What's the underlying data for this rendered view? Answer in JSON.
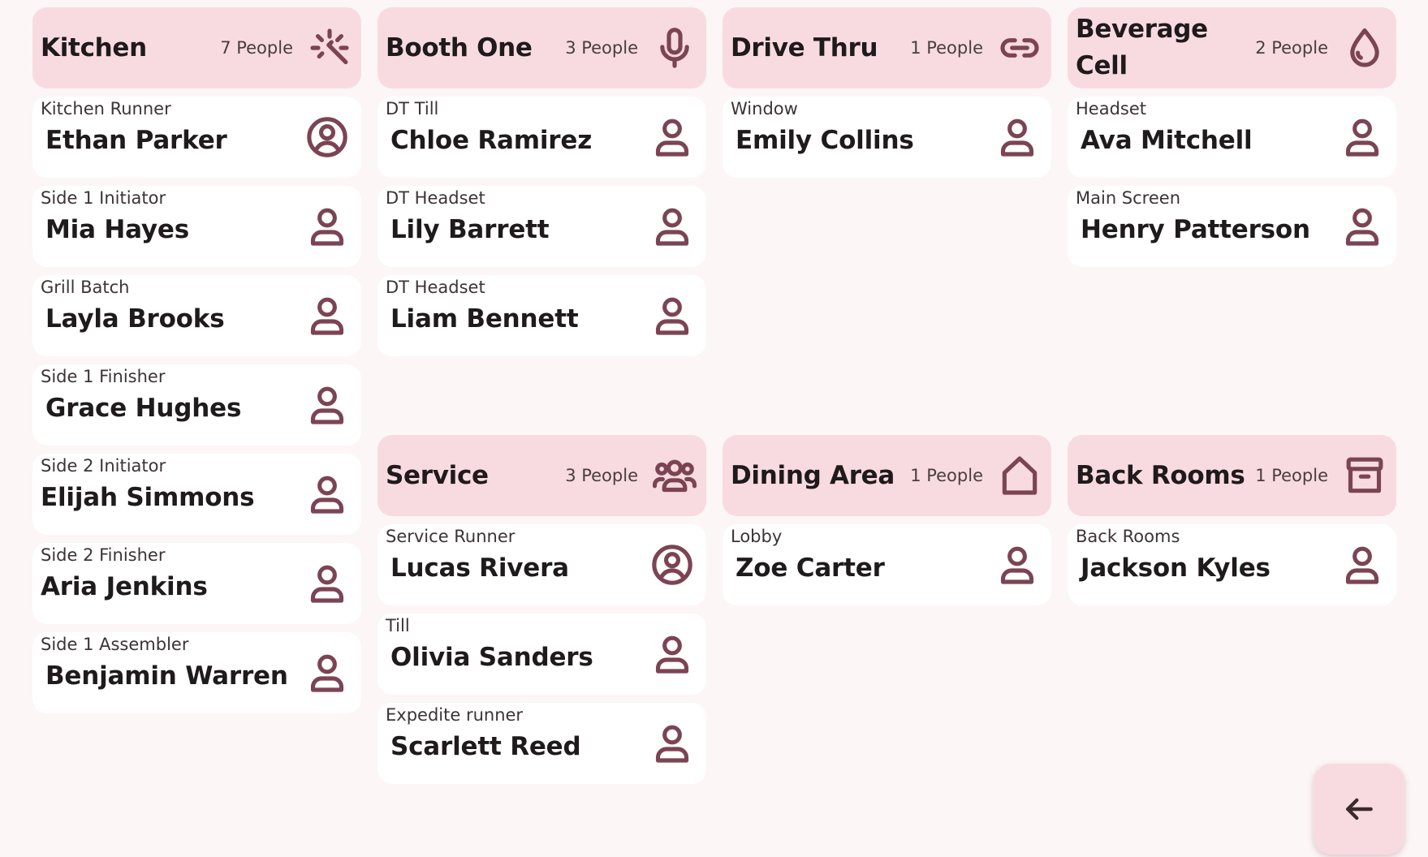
{
  "colors": {
    "background": "#fdf6f6",
    "header": "#f8dbe0",
    "card": "#ffffff",
    "accent": "#7b4454"
  },
  "sections": {
    "kitchen": {
      "title": "Kitchen",
      "count": "7 People",
      "icon": "magic-wand-icon",
      "people": [
        {
          "role": "Kitchen Runner",
          "name": "Ethan Parker",
          "icon": "user-circle-icon"
        },
        {
          "role": "Side 1 Initiator",
          "name": "Mia Hayes",
          "icon": "user-icon"
        },
        {
          "role": "Grill Batch",
          "name": "Layla Brooks",
          "icon": "user-icon"
        },
        {
          "role": "Side 1 Finisher",
          "name": "Grace Hughes",
          "icon": "user-icon"
        },
        {
          "role": "Side 2 Initiator",
          "name": "Elijah Simmons",
          "icon": "user-icon"
        },
        {
          "role": "Side 2 Finisher",
          "name": "Aria Jenkins",
          "icon": "user-icon"
        },
        {
          "role": "Side 1 Assembler",
          "name": "Benjamin Warren",
          "icon": "user-icon"
        }
      ]
    },
    "booth_one": {
      "title": "Booth One",
      "count": "3 People",
      "icon": "microphone-icon",
      "people": [
        {
          "role": "DT Till",
          "name": "Chloe Ramirez",
          "icon": "user-icon"
        },
        {
          "role": "DT Headset",
          "name": "Lily Barrett",
          "icon": "user-icon"
        },
        {
          "role": "DT Headset",
          "name": "Liam Bennett",
          "icon": "user-icon"
        }
      ]
    },
    "drive_thru": {
      "title": "Drive Thru",
      "count": "1 People",
      "icon": "link-icon",
      "people": [
        {
          "role": "Window",
          "name": "Emily Collins",
          "icon": "user-icon"
        }
      ]
    },
    "beverage_cell": {
      "title": "Beverage Cell",
      "count": "2 People",
      "icon": "droplet-icon",
      "people": [
        {
          "role": "Headset",
          "name": "Ava Mitchell",
          "icon": "user-icon"
        },
        {
          "role": "Main Screen",
          "name": "Henry Patterson",
          "icon": "user-icon"
        }
      ]
    },
    "service": {
      "title": "Service",
      "count": "3 People",
      "icon": "users-group-icon",
      "people": [
        {
          "role": "Service Runner",
          "name": "Lucas Rivera",
          "icon": "user-circle-icon"
        },
        {
          "role": "Till",
          "name": "Olivia Sanders",
          "icon": "user-icon"
        },
        {
          "role": "Expedite runner",
          "name": "Scarlett Reed",
          "icon": "user-icon"
        }
      ]
    },
    "dining_area": {
      "title": "Dining Area",
      "count": "1 People",
      "icon": "home-icon",
      "people": [
        {
          "role": "Lobby",
          "name": "Zoe Carter",
          "icon": "user-icon"
        }
      ]
    },
    "back_rooms": {
      "title": "Back Rooms",
      "count": "1 People",
      "icon": "archive-box-icon",
      "people": [
        {
          "role": "Back Rooms",
          "name": "Jackson Kyles",
          "icon": "user-icon"
        }
      ]
    }
  },
  "back_button": {
    "icon": "arrow-left-icon"
  }
}
